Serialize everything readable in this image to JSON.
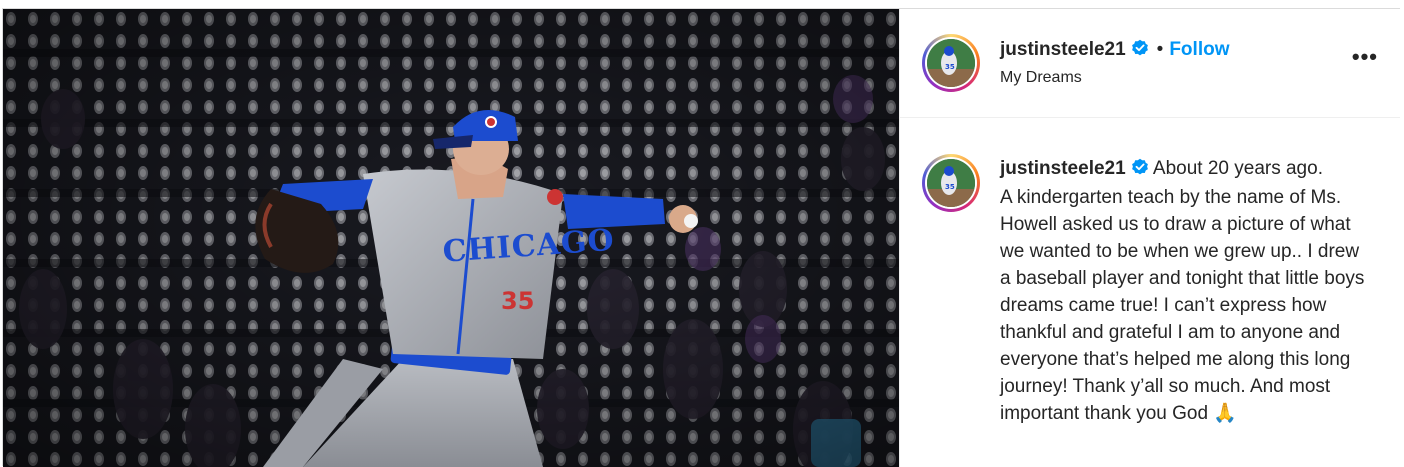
{
  "post": {
    "username": "justinsteele21",
    "verified": true,
    "follow_label": "Follow",
    "separator": "•",
    "subtitle": "My Dreams",
    "more_label": "•••"
  },
  "caption": {
    "username": "justinsteele21",
    "text": "About 20 years ago.\nA kindergarten teach by the name of Ms. Howell asked us to draw a picture of what we wanted to be when we grew up.. I drew a baseball player and tonight that little boys dreams came true! I can’t express how thankful and grateful I am to anyone and everyone that’s helped me along this long journey! Thank y’all so much. And most important thank you God 🙏"
  },
  "photo": {
    "jersey_text": "CHICAGO",
    "jersey_number": "35"
  },
  "icons": {
    "verified": "verified-badge-icon",
    "more": "more-options-icon"
  },
  "colors": {
    "follow": "#0095f6",
    "verified": "#0095f6",
    "text": "#262626",
    "cubs_blue": "#1c4ccf",
    "cubs_red": "#cc3433"
  }
}
